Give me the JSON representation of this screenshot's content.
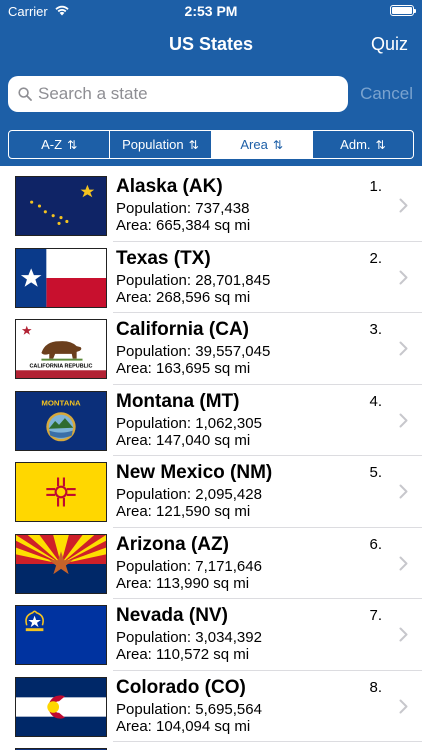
{
  "status": {
    "carrier": "Carrier",
    "time": "2:53 PM"
  },
  "nav": {
    "title": "US States",
    "quiz": "Quiz"
  },
  "search": {
    "placeholder": "Search a state",
    "value": "",
    "cancel": "Cancel"
  },
  "segments": [
    {
      "label": "A-Z",
      "active": false
    },
    {
      "label": "Population",
      "active": false
    },
    {
      "label": "Area",
      "active": true
    },
    {
      "label": "Adm.",
      "active": false
    }
  ],
  "sort_glyph": "⇅",
  "states": [
    {
      "name": "Alaska (AK)",
      "population": "Population: 737,438",
      "area": "Area: 665,384 sq mi",
      "rank": "1.",
      "flag": "alaska-flag-icon"
    },
    {
      "name": "Texas (TX)",
      "population": "Population: 28,701,845",
      "area": "Area: 268,596 sq mi",
      "rank": "2.",
      "flag": "texas-flag-icon"
    },
    {
      "name": "California (CA)",
      "population": "Population: 39,557,045",
      "area": "Area: 163,695 sq mi",
      "rank": "3.",
      "flag": "california-flag-icon",
      "flag_text": "CALIFORNIA REPUBLIC"
    },
    {
      "name": "Montana (MT)",
      "population": "Population: 1,062,305",
      "area": "Area: 147,040 sq mi",
      "rank": "4.",
      "flag": "montana-flag-icon",
      "flag_text": "MONTANA"
    },
    {
      "name": "New Mexico (NM)",
      "population": "Population: 2,095,428",
      "area": "Area: 121,590 sq mi",
      "rank": "5.",
      "flag": "new-mexico-flag-icon"
    },
    {
      "name": "Arizona (AZ)",
      "population": "Population: 7,171,646",
      "area": "Area: 113,990 sq mi",
      "rank": "6.",
      "flag": "arizona-flag-icon"
    },
    {
      "name": "Nevada (NV)",
      "population": "Population: 3,034,392",
      "area": "Area: 110,572 sq mi",
      "rank": "7.",
      "flag": "nevada-flag-icon"
    },
    {
      "name": "Colorado (CO)",
      "population": "Population: 5,695,564",
      "area": "Area: 104,094 sq mi",
      "rank": "8.",
      "flag": "colorado-flag-icon"
    }
  ],
  "colors": {
    "header": "#1d5fa7",
    "cancel": "#7aa3cf",
    "separator": "#dcdce0"
  }
}
